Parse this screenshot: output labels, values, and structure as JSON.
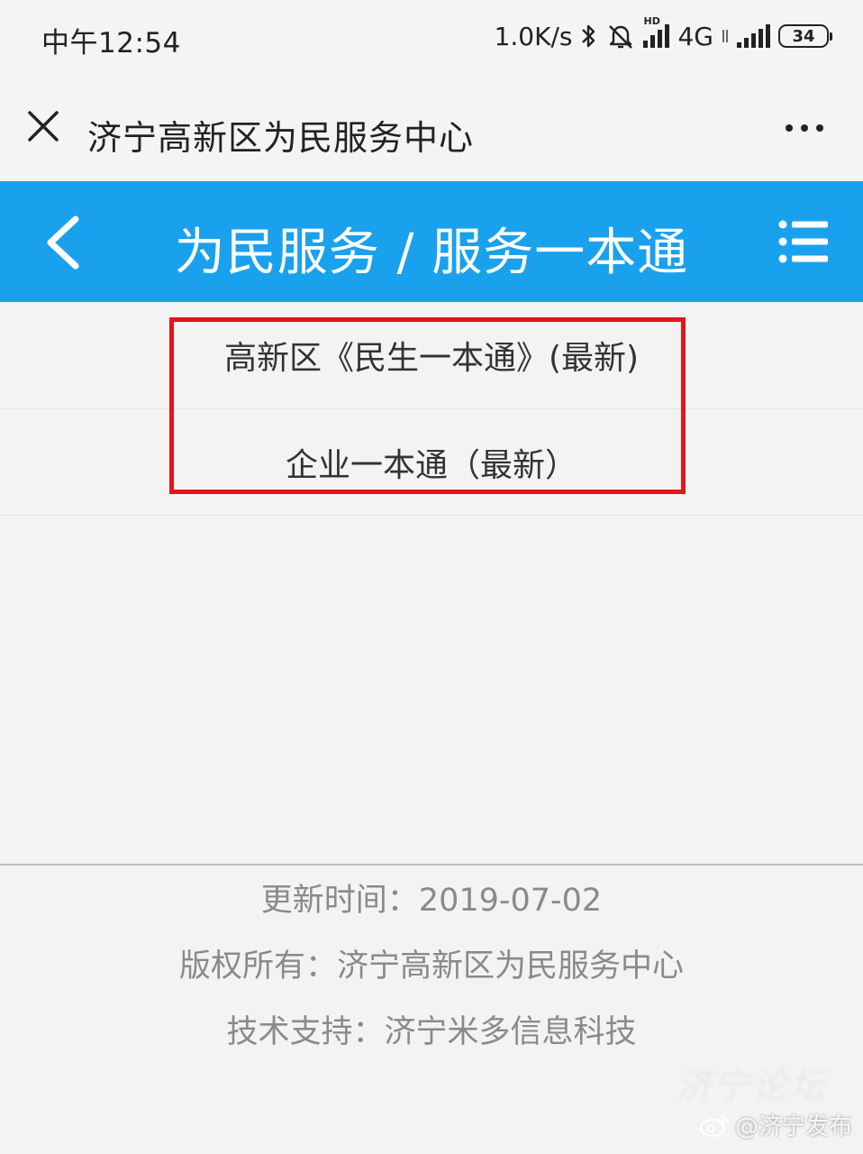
{
  "status_bar": {
    "time": "中午12:54",
    "net_speed": "1.0K/s",
    "network_type": "4G",
    "hd_label": "HD",
    "battery": "34",
    "icons": [
      "bluetooth-icon",
      "mute-icon",
      "signal-icon",
      "wifi-data-icon"
    ]
  },
  "titlebar": {
    "title": "济宁高新区为民服务中心"
  },
  "navbar": {
    "title": "为民服务 / 服务一本通",
    "color": "#1aa1ee"
  },
  "list": {
    "items": [
      {
        "label": "高新区《民生一本通》(最新)"
      },
      {
        "label": "企业一本通（最新）"
      }
    ],
    "highlight_color": "#e3141d"
  },
  "footer": {
    "update_time": "更新时间：2019-07-02",
    "copyright": "版权所有：济宁高新区为民服务中心",
    "tech_support": "技术支持：济宁米多信息科技"
  },
  "watermark": {
    "handle": "@济宁发布",
    "faint_text": "济宁论坛"
  }
}
